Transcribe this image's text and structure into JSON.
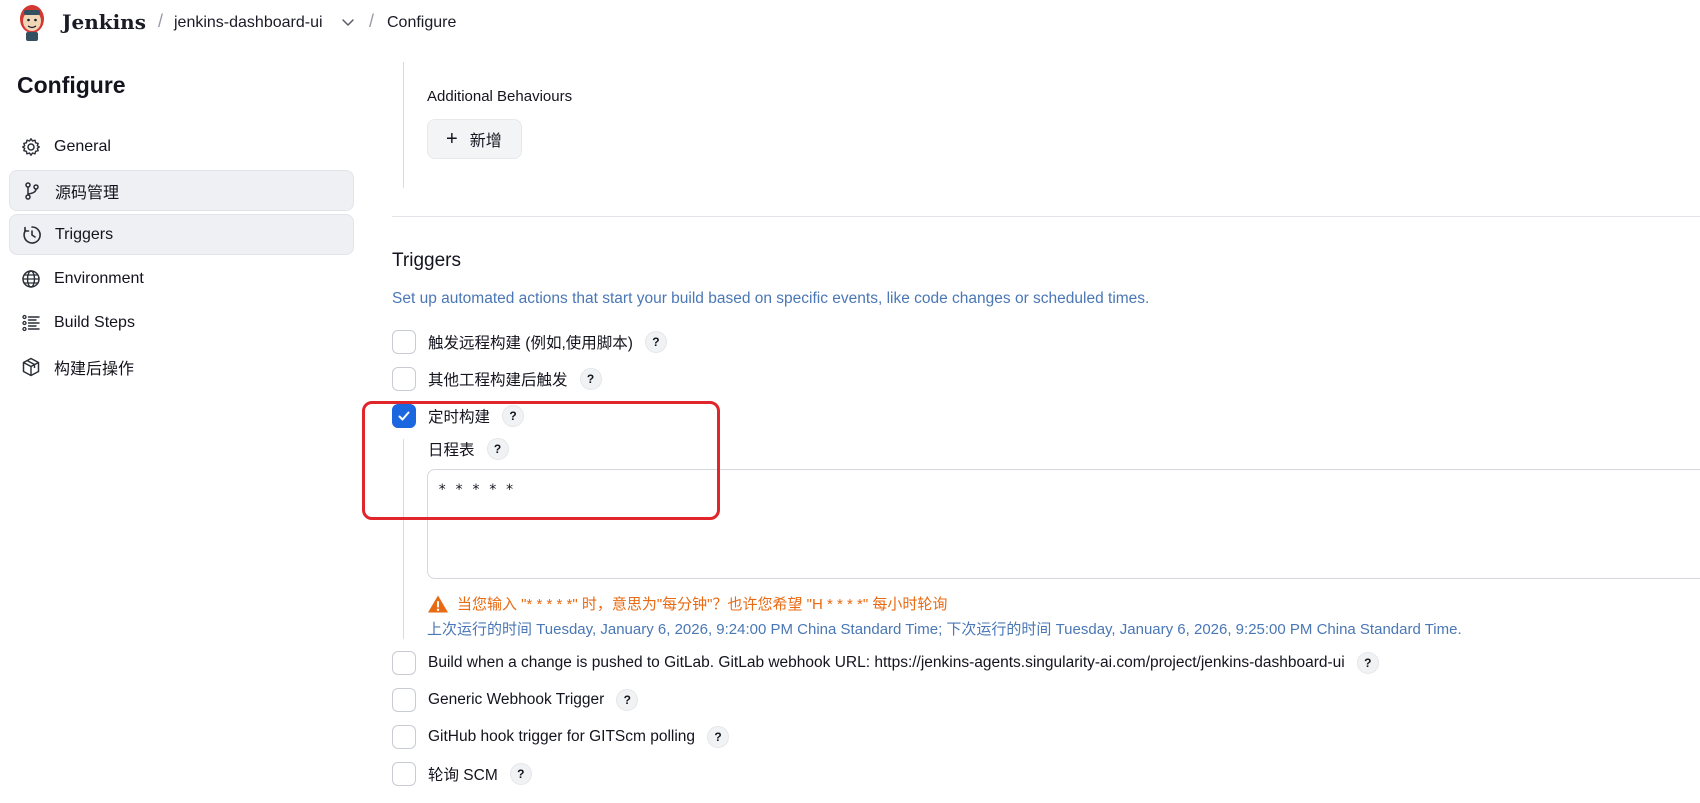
{
  "header": {
    "brand": "Jenkins",
    "breadcrumb": [
      {
        "label": "jenkins-dashboard-ui"
      },
      {
        "label": "Configure"
      }
    ]
  },
  "sidebar": {
    "title": "Configure",
    "items": [
      {
        "label": "General",
        "icon": "gear-icon"
      },
      {
        "label": "源码管理",
        "icon": "branch-icon"
      },
      {
        "label": "Triggers",
        "icon": "clock-icon"
      },
      {
        "label": "Environment",
        "icon": "globe-icon"
      },
      {
        "label": "Build Steps",
        "icon": "list-icon"
      },
      {
        "label": "构建后操作",
        "icon": "package-icon"
      }
    ]
  },
  "scm": {
    "additional_behaviours_label": "Additional Behaviours",
    "add_button_label": "新增"
  },
  "triggers": {
    "title": "Triggers",
    "description": "Set up automated actions that start your build based on specific events, like code changes or scheduled times.",
    "options": [
      {
        "label": "触发远程构建 (例如,使用脚本)",
        "checked": false
      },
      {
        "label": "其他工程构建后触发",
        "checked": false
      },
      {
        "label": "定时构建",
        "checked": true
      },
      {
        "label": "Build when a change is pushed to GitLab. GitLab webhook URL: https://jenkins-agents.singularity-ai.com/project/jenkins-dashboard-ui",
        "checked": false
      },
      {
        "label": "Generic Webhook Trigger",
        "checked": false
      },
      {
        "label": "GitHub hook trigger for GITScm polling",
        "checked": false
      },
      {
        "label": "轮询 SCM",
        "checked": false
      }
    ],
    "schedule": {
      "label": "日程表",
      "value": "* * * * *",
      "warning": "当您输入 \"* * * * *\" 时，意思为\"每分钟\"？也许您希望 \"H * * * *\" 每小时轮询",
      "info": "上次运行的时间 Tuesday, January 6, 2026, 9:24:00 PM China Standard Time; 下次运行的时间 Tuesday, January 6, 2026, 9:25:00 PM China Standard Time."
    },
    "help_label": "?"
  },
  "colors": {
    "accent": "#1a67e0",
    "warning": "#e86a12",
    "info_text": "#4a77b5",
    "highlight": "#e0252b"
  }
}
